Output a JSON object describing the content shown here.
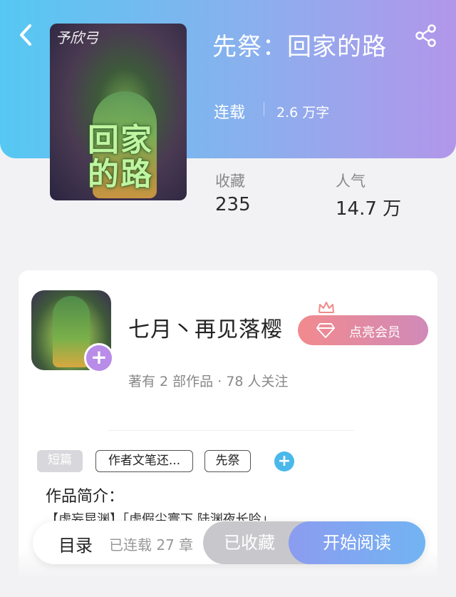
{
  "header": {
    "book_title": "先祭：回家的路",
    "status": "连载",
    "word_count": "2.6 万字",
    "cover": {
      "signature": "予欣弓",
      "title_line1": "回家",
      "title_line2": "的路"
    }
  },
  "stats": [
    {
      "label": "收藏",
      "value": "235"
    },
    {
      "label": "人气",
      "value": "14.7 万"
    }
  ],
  "author": {
    "name": "七月丶再见落樱",
    "meta": "著有 2 部作品 · 78 人关注",
    "vip_label": "点亮会员",
    "follow_symbol": "+"
  },
  "tags": [
    "短篇",
    "作者文笔还...",
    "先祭"
  ],
  "tag_add_symbol": "+",
  "intro": {
    "label": "作品简介：",
    "text": "【虚妄昆渊】「虚假尘寰下 陆渊夜长吟」"
  },
  "bottom_bar": {
    "toc_label": "目录",
    "chapters": "已连载 27 章",
    "collected_label": "已收藏",
    "read_label": "开始阅读"
  },
  "colors": {
    "header_gradient_start": "#55c8f2",
    "header_gradient_end": "#b296ea",
    "vip_pink": "#f28a8e",
    "follow_purple": "#b88ce8",
    "add_tag_blue": "#4ab8ea"
  },
  "icons": {
    "back": "chevron-left-icon",
    "share": "share-icon",
    "crown": "crown-icon",
    "diamond": "diamond-icon"
  }
}
